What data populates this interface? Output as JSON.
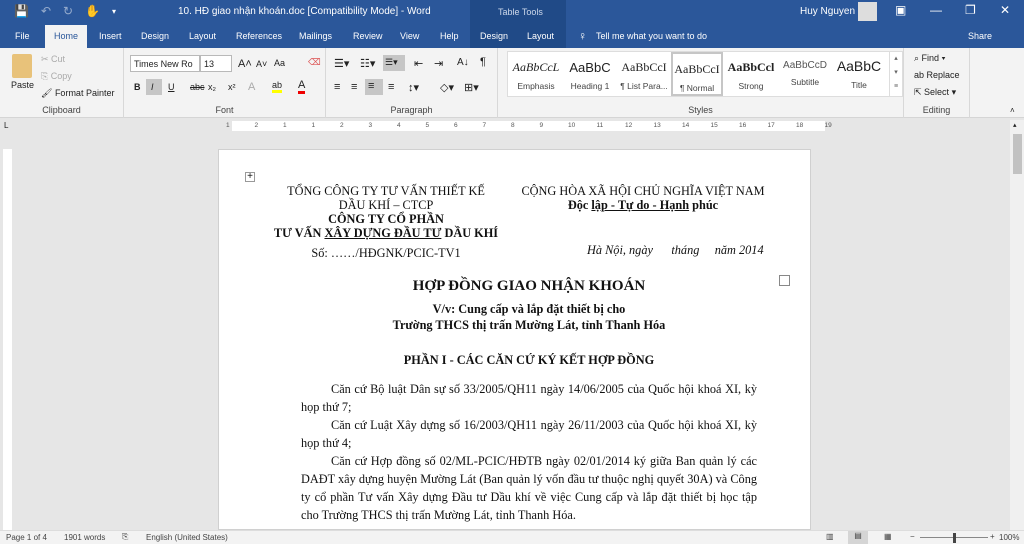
{
  "window": {
    "title": "10. HĐ giao nhận khoán.doc [Compatibility Mode]  -  Word",
    "context_tab": "Table Tools",
    "user": "Huy Nguyen"
  },
  "tabs": [
    "File",
    "Home",
    "Insert",
    "Design",
    "Layout",
    "References",
    "Mailings",
    "Review",
    "View",
    "Help",
    "Design",
    "Layout"
  ],
  "tell_me": "Tell me what you want to do",
  "share": "Share",
  "clipboard": {
    "paste": "Paste",
    "cut": "Cut",
    "copy": "Copy",
    "format_painter": "Format Painter",
    "label": "Clipboard"
  },
  "font": {
    "name": "Times New Ro",
    "size": "13",
    "label": "Font",
    "bold": "B",
    "italic": "I",
    "underline": "U",
    "strike": "abc",
    "sub": "x₂",
    "sup": "x²",
    "case": "Aa"
  },
  "paragraph": {
    "label": "Paragraph"
  },
  "styles": {
    "label": "Styles",
    "items": [
      {
        "sample": "AaBbCcL",
        "name": "Emphasis"
      },
      {
        "sample": "AaBbC",
        "name": "Heading 1"
      },
      {
        "sample": "AaBbCcI",
        "name": "¶ List Para..."
      },
      {
        "sample": "AaBbCcI",
        "name": "¶ Normal"
      },
      {
        "sample": "AaBbCcl",
        "name": "Strong"
      },
      {
        "sample": "AaBbCcD",
        "name": "Subtitle"
      },
      {
        "sample": "AaBbC",
        "name": "Title"
      }
    ]
  },
  "editing": {
    "find": "Find",
    "replace": "Replace",
    "select": "Select",
    "label": "Editing"
  },
  "ruler": [
    "1",
    "2",
    "1",
    "1",
    "2",
    "3",
    "4",
    "5",
    "6",
    "7",
    "8",
    "9",
    "10",
    "11",
    "12",
    "13",
    "14",
    "15",
    "16",
    "17",
    "18",
    "19"
  ],
  "doc": {
    "left_h1": "TỔNG CÔNG TY TƯ VẤN THIẾT KẾ",
    "left_h2": "DẦU KHÍ – CTCP",
    "left_h3": "CÔNG TY CỔ PHẦN",
    "left_h4a": "TƯ VẤN ",
    "left_h4b": "XÂY DỰNG ĐẦU TƯ",
    "left_h4c": " DẦU KHÍ",
    "so": "Số: ……/HĐGNK/PCIC-TV1",
    "right_h1": "CỘNG HÒA XÃ HỘI CHỦ NGHĨA VIỆT NAM",
    "right_h2a": "Độc ",
    "right_h2b": "lập - Tự do - Hạnh",
    "right_h2c": " phúc",
    "date": "Hà Nội, ngày      tháng     năm 2014",
    "title": "HỢP ĐỒNG GIAO NHẬN KHOÁN",
    "sub1": "V/v: Cung cấp và lắp đặt thiết bị cho",
    "sub2": "Trường THCS thị trấn Mường Lát, tỉnh Thanh Hóa",
    "section": "PHẦN I - CÁC CĂN CỨ KÝ KẾT HỢP ĐỒNG",
    "paras": [
      "Căn cứ Bộ luật Dân sự số 33/2005/QH11 ngày 14/06/2005 của Quốc hội khoá XI, kỳ họp thứ 7;",
      "Căn cứ Luật Xây dựng số 16/2003/QH11 ngày 26/11/2003 của Quốc hội khoá XI, kỳ họp thứ 4;",
      "Căn cứ Hợp đồng số 02/ML-PCIC/HĐTB ngày 02/01/2014 ký giữa Ban quản lý các DAĐT xây dựng huyện Mường Lát (Ban quản lý vốn đầu tư thuộc nghị quyết 30A) và Công ty cổ phần Tư vấn Xây dựng Đầu tư Dầu khí về việc Cung cấp và lắp đặt thiết bị học tập cho Trường THCS thị trấn Mường Lát, tỉnh Thanh Hóa."
    ]
  },
  "status": {
    "page": "Page 1 of 4",
    "words": "1901 words",
    "lang": "English (United States)",
    "zoom": "100%",
    "zoom_level": 100
  }
}
